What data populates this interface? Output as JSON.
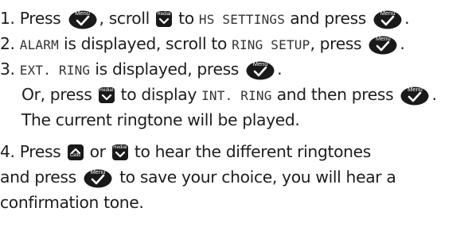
{
  "keys": {
    "menu": "Menu",
    "redial": "Redial",
    "calls": "Calls"
  },
  "steps": [
    {
      "num": "1.",
      "press": "Press",
      "scroll": ", scroll",
      "to": "to",
      "item": "HS SETTINGS",
      "and_press": "and press",
      "end": "."
    },
    {
      "num": "2.",
      "item": "ALARM",
      "is_displayed": "is displayed, scroll to",
      "item2": "RING SETUP",
      "press": ", press",
      "end": "."
    },
    {
      "num": "3.",
      "item": "EXT. RING",
      "is_displayed": "is displayed, press",
      "end": ".",
      "or_press": "Or, press",
      "to_display": "to display",
      "item2": "INT. RING",
      "then_press": "and then press",
      "end2": ".",
      "current": "The current ringtone will be played."
    },
    {
      "num": "4.",
      "press": "Press",
      "or": "or",
      "hear": "to hear the different ringtones",
      "and_press": "and press",
      "save": "to save your choice, you will hear a",
      "confirm": "confirmation tone."
    }
  ]
}
